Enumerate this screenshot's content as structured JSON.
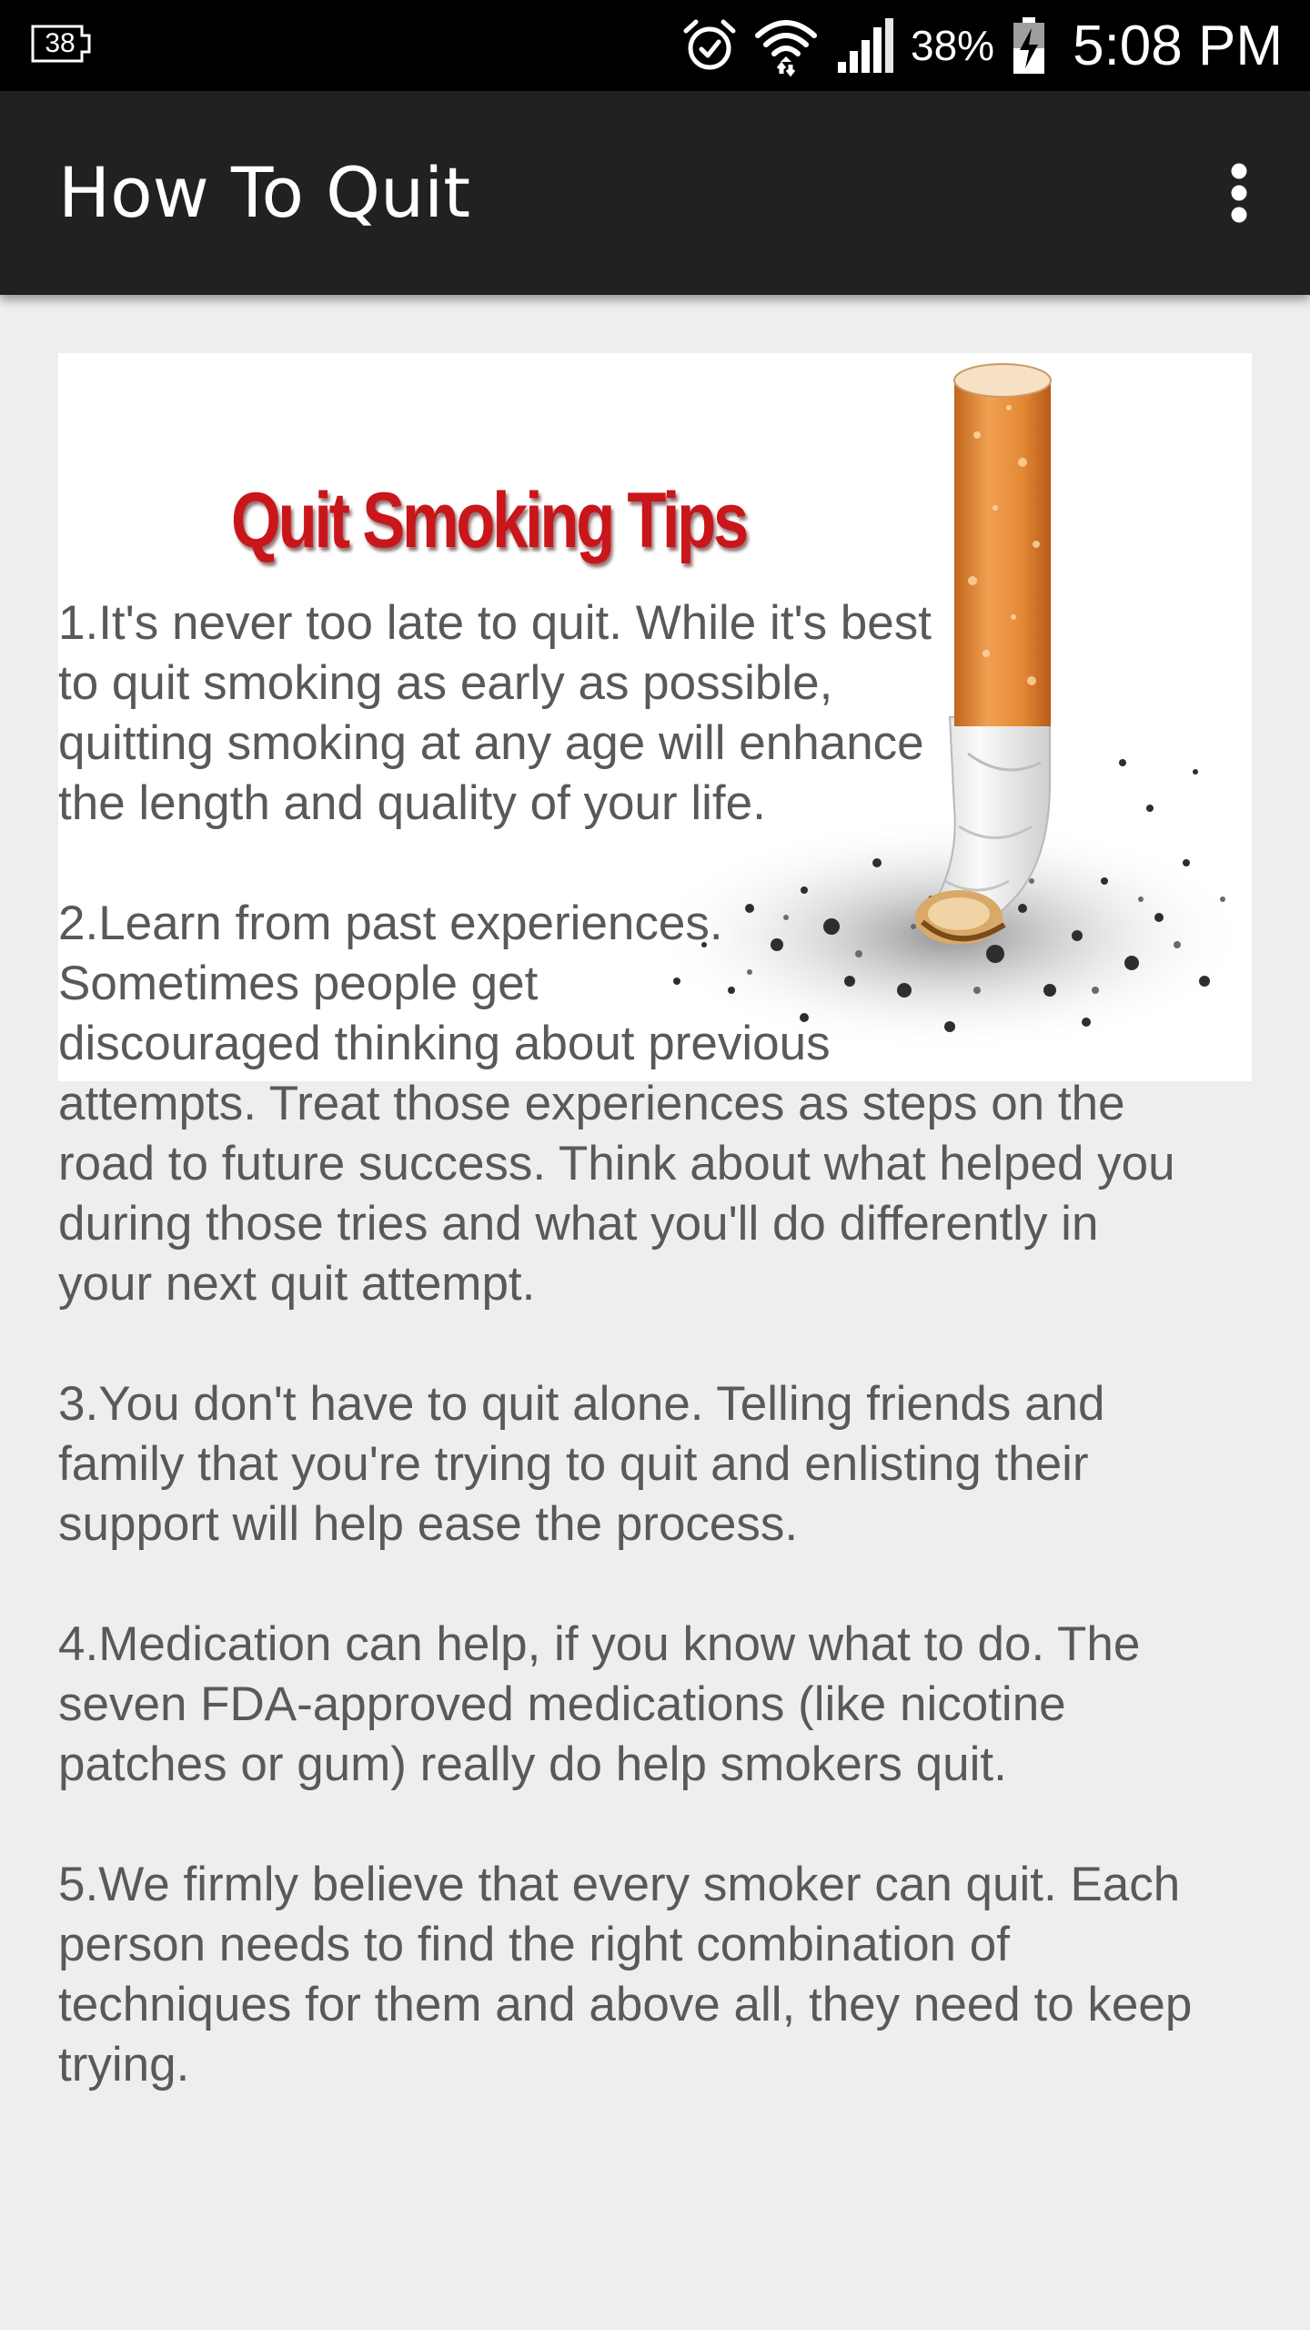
{
  "status_bar": {
    "notification_count": "38",
    "battery_percent": "38%",
    "time": "5:08 PM",
    "icons": [
      "notification-badge-icon",
      "alarm-icon",
      "wifi-icon",
      "cell-signal-icon",
      "battery-charging-icon"
    ]
  },
  "app_bar": {
    "title": "How To Quit",
    "menu_icon": "more-vert-icon"
  },
  "hero": {
    "title": "Quit Smoking Tips",
    "title_color": "#c8161b",
    "image": "cigarette-butt-ashes-image"
  },
  "tips": [
    "1.It's never too late to quit. While it's best\nto quit smoking as early as possible,\nquitting smoking at any age will enhance\nthe length and quality of your life.",
    "2.Learn from past experiences.\nSometimes people get\ndiscouraged thinking about previous\nattempts. Treat those experiences as steps on the\nroad to future success. Think about what helped you\nduring those tries and what you'll do differently in\nyour next quit attempt.",
    "3.You don't have to quit alone. Telling friends and\nfamily that you're trying to quit and enlisting their\nsupport will help ease the process.",
    "4.Medication can help, if you know what to do. The\nseven FDA-approved medications (like nicotine\npatches or gum) really do help smokers quit.",
    "5.We firmly believe that every smoker can quit. Each\nperson needs to find the right combination of\ntechniques for them and above all, they need to keep\ntrying."
  ],
  "colors": {
    "status_bar_bg": "#000000",
    "app_bar_bg": "#212121",
    "content_bg": "#eeeeee",
    "body_text": "#595959"
  }
}
